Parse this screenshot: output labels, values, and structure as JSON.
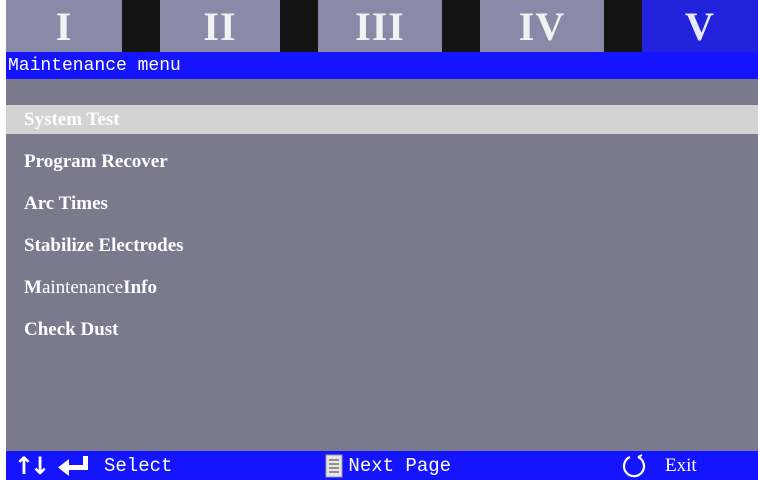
{
  "tabs": [
    {
      "label": "I",
      "active": false
    },
    {
      "label": "II",
      "active": false
    },
    {
      "label": "III",
      "active": false
    },
    {
      "label": "IV",
      "active": false
    },
    {
      "label": "V",
      "active": true
    }
  ],
  "title": "Maintenance menu",
  "menu": {
    "items": [
      {
        "label": "System Test",
        "selected": true
      },
      {
        "label": "Program Recover",
        "selected": false
      },
      {
        "label": "Arc Times",
        "selected": false
      },
      {
        "label": "Stabilize Electrodes",
        "selected": false
      },
      {
        "label_bold_1": "M",
        "label_light": "aintenance ",
        "label_bold_2": "Info",
        "selected": false
      },
      {
        "label": "Check Dust",
        "selected": false
      }
    ]
  },
  "bottom_bar": {
    "select_label": "Select",
    "next_page_label": "Next Page",
    "exit_label": "Exit",
    "icons": [
      "up-down-arrows-icon",
      "enter-icon",
      "page-icon",
      "exit-circle-icon"
    ]
  },
  "colors": {
    "background": "#7b7a8d",
    "bar_blue": "#1414ff",
    "selection": "#d3d3d3",
    "tab_inactive": "#8a89a8",
    "tab_active": "#2222dd"
  }
}
